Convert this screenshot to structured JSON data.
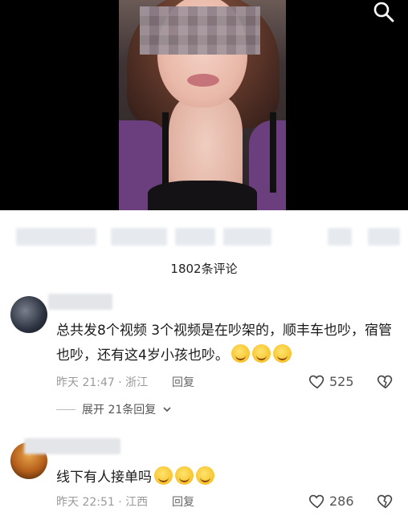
{
  "comments_header": {
    "count_label": "1802条评论"
  },
  "comments": [
    {
      "text": "总共发8个视频 3个视频是在吵架的，顺丰车也吵，宿管也吵，还有这4岁小孩也吵。",
      "emoji_count": 3,
      "time": "昨天 21:47",
      "location": "浙江",
      "reply_label": "回复",
      "likes": "525",
      "expand_label": "展开 21条回复"
    },
    {
      "text": "线下有人接单吗",
      "emoji_count": 3,
      "time": "昨天 22:51",
      "location": "江西",
      "reply_label": "回复",
      "likes": "286"
    }
  ],
  "icons": {
    "search": "search-icon",
    "like": "heart-icon",
    "dislike": "broken-heart-icon",
    "expand": "chevron-down-icon"
  },
  "colors": {
    "text": "#1a1a1a",
    "meta": "#9a9a9a",
    "video_bg": "#000000"
  }
}
